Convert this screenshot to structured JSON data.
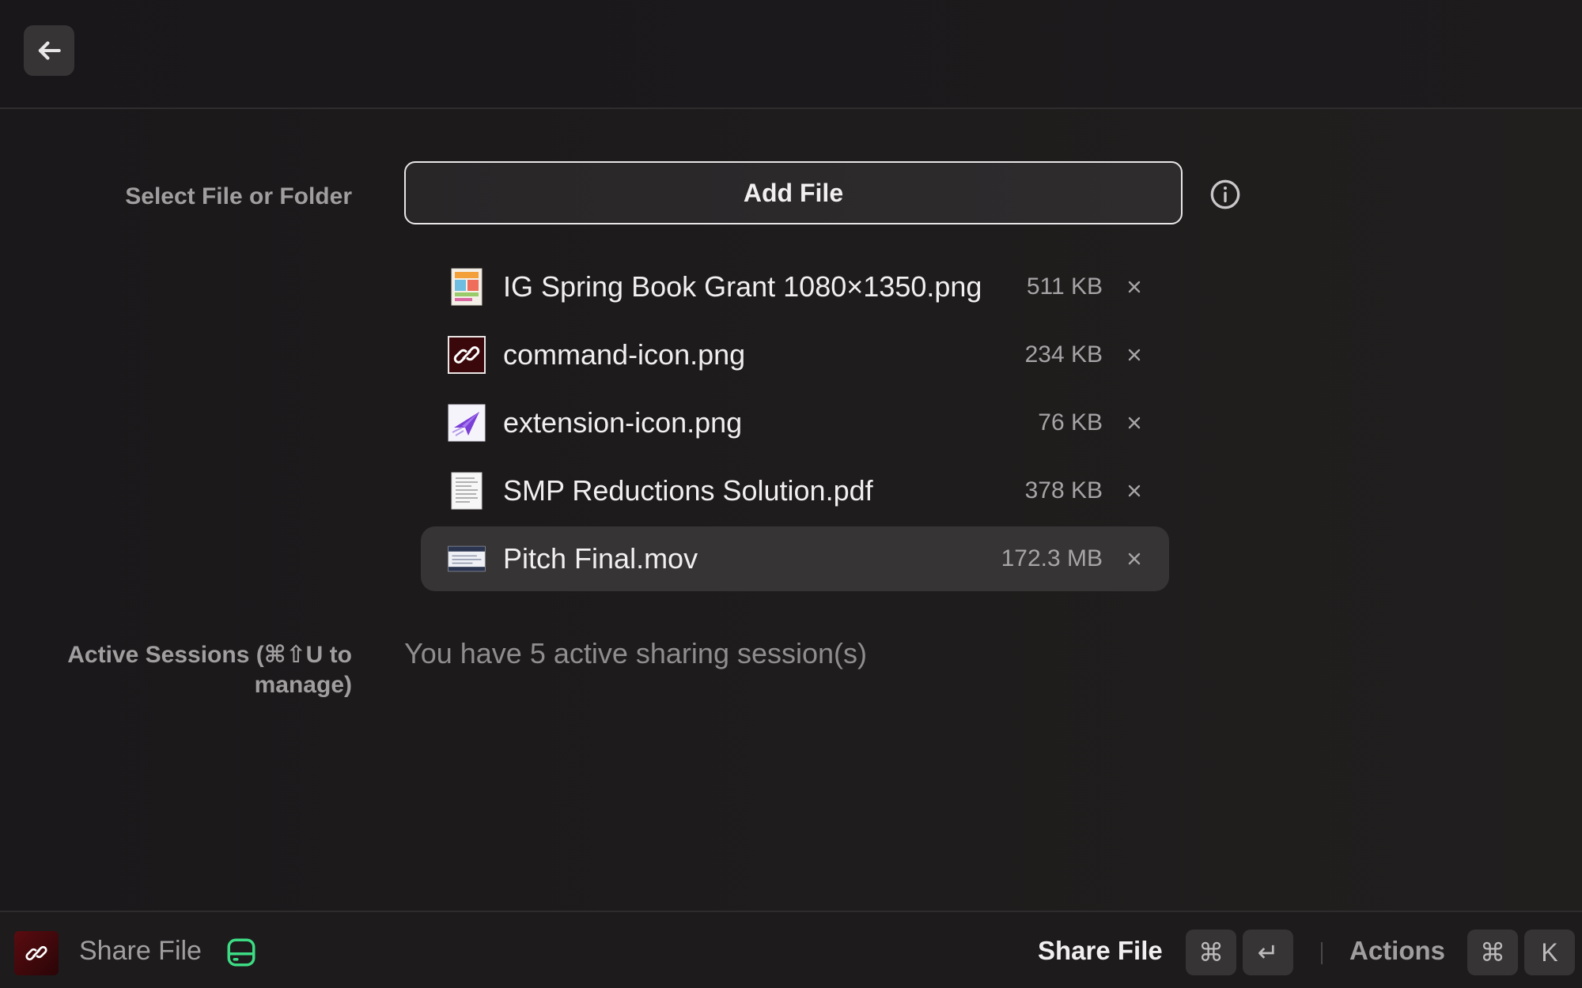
{
  "header": {
    "back_icon": "arrow-left-icon"
  },
  "form": {
    "select_label": "Select File or Folder",
    "add_file_label": "Add File",
    "info_icon": "info-icon",
    "sessions_label": "Active Sessions (⌘⇧U to manage)",
    "sessions_text": "You have 5 active sharing session(s)"
  },
  "files": [
    {
      "name": "IG Spring Book Grant 1080×1350.png",
      "size": "511 KB",
      "icon": "image-thumbnail-icon",
      "selected": false
    },
    {
      "name": "command-icon.png",
      "size": "234 KB",
      "icon": "link-thumbnail-icon",
      "selected": false
    },
    {
      "name": "extension-icon.png",
      "size": "76 KB",
      "icon": "paper-plane-thumbnail-icon",
      "selected": false
    },
    {
      "name": "SMP Reductions Solution.pdf",
      "size": "378 KB",
      "icon": "document-thumbnail-icon",
      "selected": false
    },
    {
      "name": "Pitch Final.mov",
      "size": "172.3 MB",
      "icon": "video-thumbnail-icon",
      "selected": true
    }
  ],
  "remove_symbol": "×",
  "footer": {
    "extension_icon": "link-icon",
    "title": "Share File",
    "drive_icon": "drive-icon",
    "primary_action": "Share File",
    "primary_keys": [
      "⌘",
      "↵"
    ],
    "actions_label": "Actions",
    "actions_keys": [
      "⌘",
      "K"
    ]
  },
  "colors": {
    "accent_green": "#3ddc84",
    "background": "#1c1a1b",
    "selected_row": "#363435"
  }
}
